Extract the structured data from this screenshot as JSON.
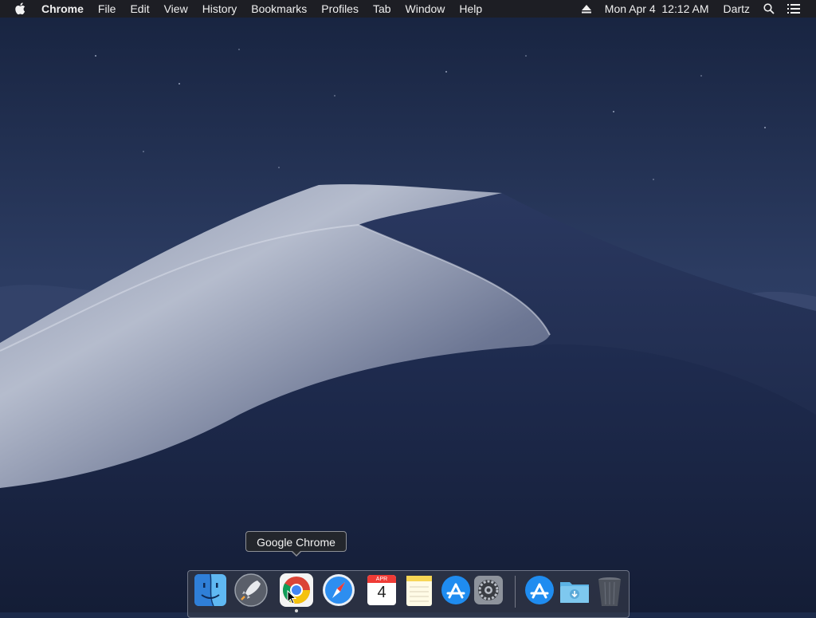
{
  "menubar": {
    "app_name": "Chrome",
    "menus": [
      "File",
      "Edit",
      "View",
      "History",
      "Bookmarks",
      "Profiles",
      "Tab",
      "Window",
      "Help"
    ],
    "clock": "Mon Apr 4  12:12 AM",
    "user": "Dartz",
    "icons": [
      "apple-icon",
      "eject-icon",
      "spotlight-search-icon",
      "notification-center-icon"
    ]
  },
  "tooltip": {
    "text": "Google Chrome"
  },
  "dock": {
    "apps": [
      "Finder",
      "Launchpad",
      "Google Chrome",
      "Safari",
      "Calendar",
      "Notes",
      "App Store",
      "System Preferences",
      "App Store",
      "Downloads",
      "Trash"
    ],
    "calendar": {
      "month": "APR",
      "day": "4"
    },
    "running_app": "Google Chrome"
  },
  "colors": {
    "sky_top": "#1a2744",
    "sky_bottom": "#34466f",
    "dune_light": "#a9b0c3",
    "dune_shadow": "#1d2a4d",
    "menubar_bg": "#1e1e22"
  }
}
